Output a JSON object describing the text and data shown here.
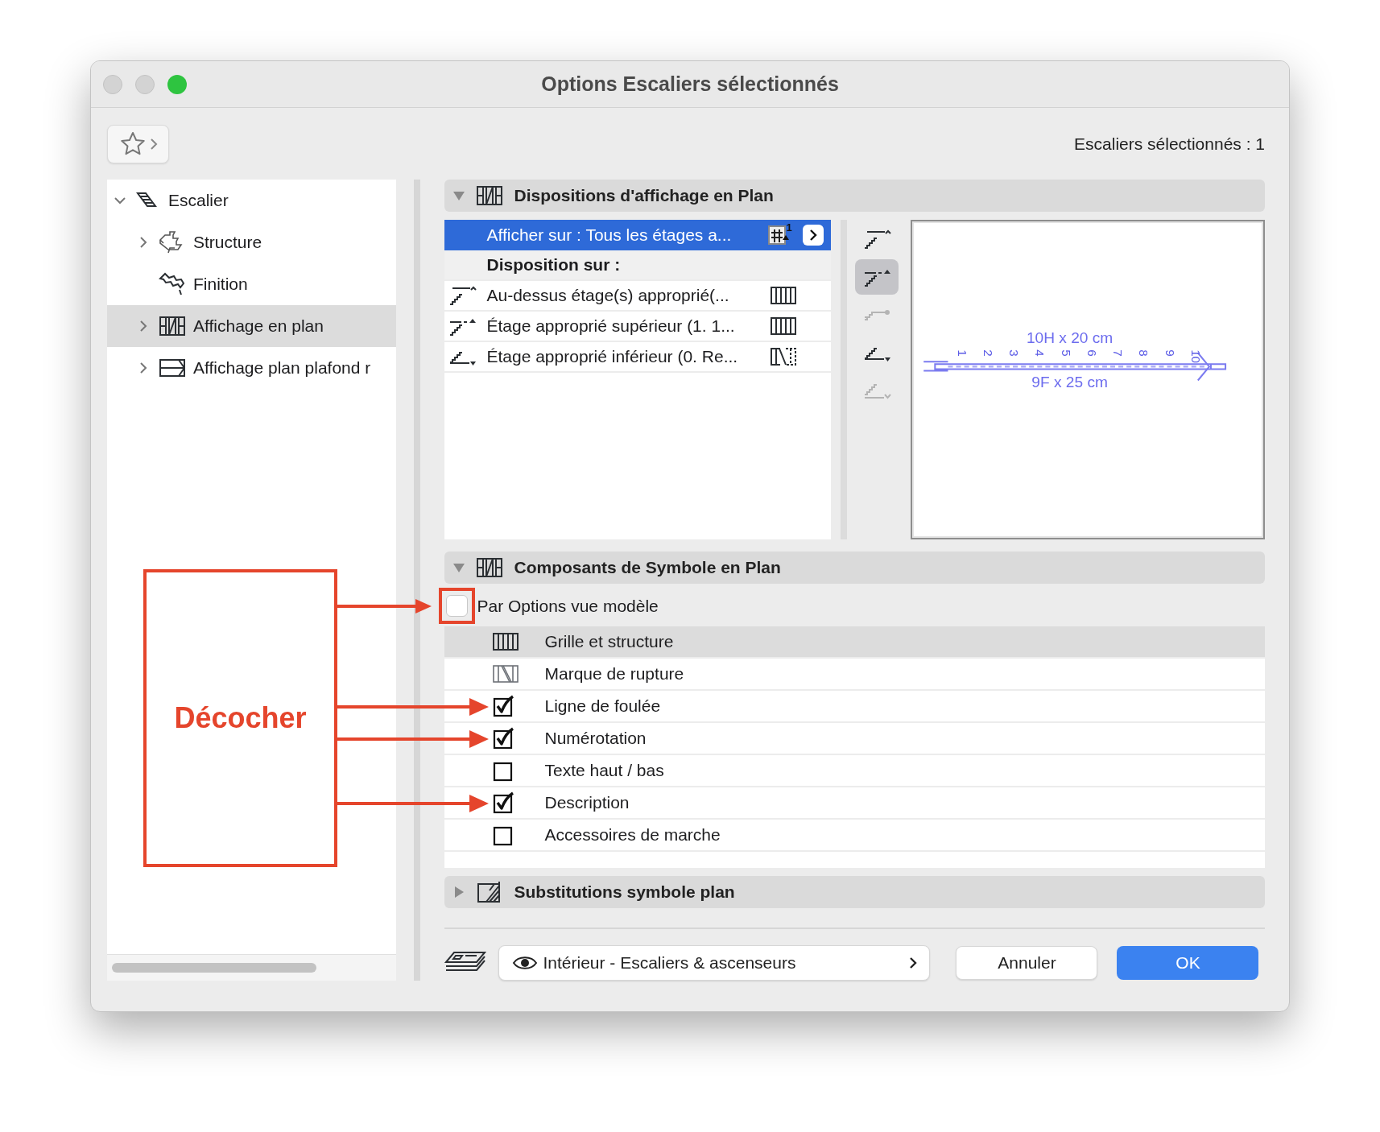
{
  "window": {
    "title": "Options Escaliers sélectionnés"
  },
  "toolbar": {
    "selection_count": "Escaliers sélectionnés : 1"
  },
  "sidebar": {
    "items": [
      {
        "label": "Escalier",
        "expanded": true,
        "selected": false,
        "children": [
          {
            "label": "Structure",
            "expanded": false,
            "selected": false
          },
          {
            "label": "Finition",
            "selected": false
          },
          {
            "label": "Affichage en plan",
            "expanded": false,
            "selected": true
          },
          {
            "label": "Affichage plan plafond r",
            "expanded": false,
            "selected": false
          }
        ]
      }
    ]
  },
  "display_settings": {
    "title": "Dispositions d'affichage en Plan",
    "expanded": true,
    "rows": [
      {
        "kind": "setting",
        "label": "Afficher sur : Tous les étages a...",
        "badge": "1",
        "selected": true
      },
      {
        "kind": "heading",
        "label": "Disposition sur :"
      },
      {
        "kind": "floor",
        "label": "Au-dessus étage(s) approprié(...",
        "selected": false
      },
      {
        "kind": "floor",
        "label": "Étage approprié supérieur (1. 1...",
        "selected": false
      },
      {
        "kind": "floor",
        "label": "Étage approprié inférieur (0. Re...",
        "selected": false
      }
    ]
  },
  "view_buttons": [
    {
      "selected": false,
      "disabled": false
    },
    {
      "selected": true,
      "disabled": false
    },
    {
      "selected": false,
      "disabled": true
    },
    {
      "selected": false,
      "disabled": false
    },
    {
      "selected": false,
      "disabled": true
    }
  ],
  "preview": {
    "dimension_top": "10H x 20 cm",
    "dimension_bottom": "9F x 25 cm",
    "step_numbers": [
      "1",
      "2",
      "3",
      "4",
      "5",
      "6",
      "7",
      "8",
      "9",
      "10"
    ]
  },
  "components": {
    "title": "Composants de Symbole en Plan",
    "expanded": true,
    "model_view_option": {
      "label": "Par Options vue modèle",
      "checked": false,
      "annotated": true
    },
    "rows": [
      {
        "kind": "pattern",
        "label": "Grille et structure",
        "selected": true
      },
      {
        "kind": "pattern",
        "label": "Marque de rupture",
        "selected": false
      },
      {
        "kind": "checkbox",
        "label": "Ligne de foulée",
        "checked": true,
        "annotated": true,
        "selected": false
      },
      {
        "kind": "checkbox",
        "label": "Numérotation",
        "checked": true,
        "annotated": true,
        "selected": false
      },
      {
        "kind": "checkbox",
        "label": "Texte haut / bas",
        "checked": false,
        "annotated": false,
        "selected": false
      },
      {
        "kind": "checkbox",
        "label": "Description",
        "checked": true,
        "annotated": true,
        "selected": false
      },
      {
        "kind": "checkbox",
        "label": "Accessoires de marche",
        "checked": false,
        "annotated": false,
        "selected": false
      }
    ]
  },
  "substitutions": {
    "title": "Substitutions symbole plan",
    "expanded": false
  },
  "footer": {
    "view": "Intérieur - Escaliers & ascenseurs",
    "buttons": [
      {
        "kind": "secondary",
        "label": "Annuler"
      },
      {
        "kind": "primary",
        "label": "OK"
      }
    ]
  },
  "annotation": {
    "label": "Décocher"
  }
}
